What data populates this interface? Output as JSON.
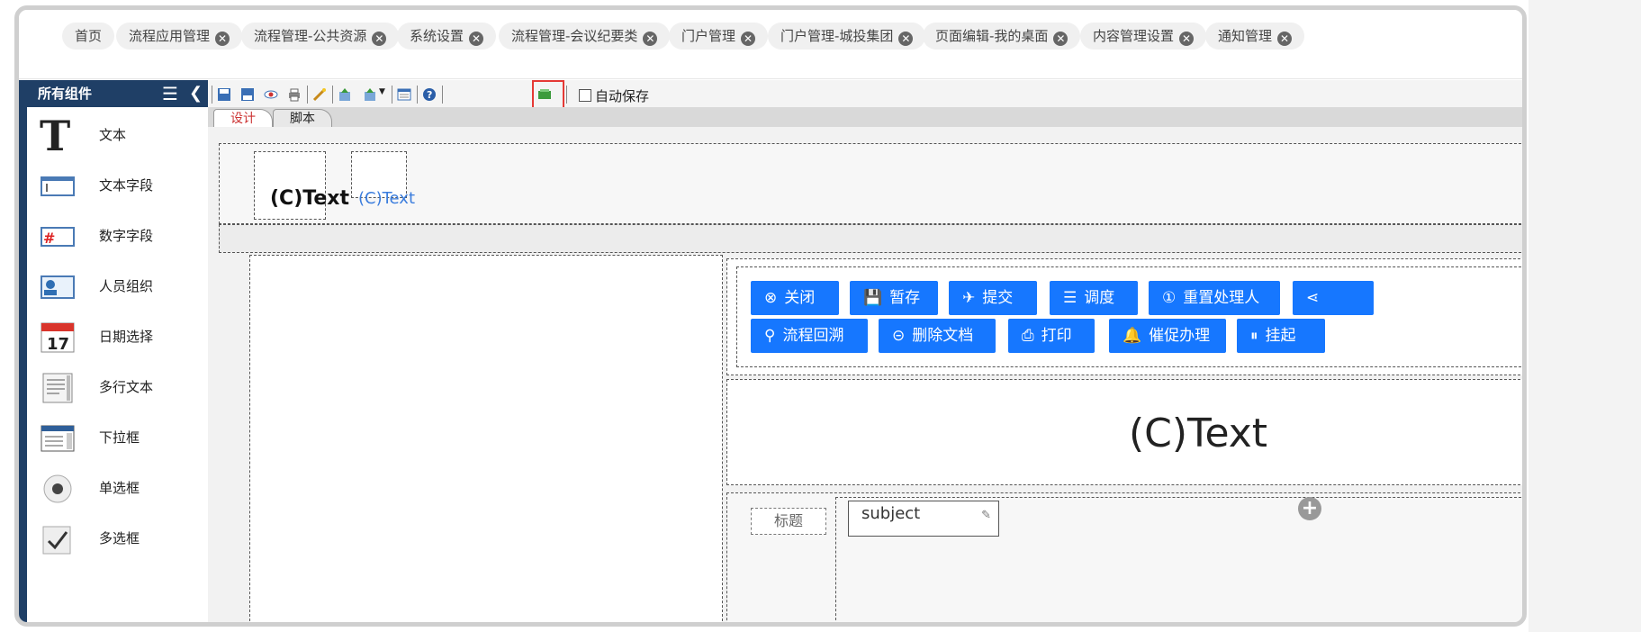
{
  "top_tabs": [
    {
      "label": "首页",
      "closable": false
    },
    {
      "label": "流程应用管理",
      "closable": true
    },
    {
      "label": "流程管理-公共资源",
      "closable": true
    },
    {
      "label": "系统设置",
      "closable": true
    },
    {
      "label": "流程管理-会议纪要类",
      "closable": true
    },
    {
      "label": "门户管理",
      "closable": true
    },
    {
      "label": "门户管理-城投集团",
      "closable": true
    },
    {
      "label": "页面编辑-我的桌面",
      "closable": true
    },
    {
      "label": "内容管理设置",
      "closable": true
    },
    {
      "label": "通知管理",
      "closable": true
    }
  ],
  "close_glyph": "✕",
  "sidebar": {
    "title": "所有组件",
    "items": [
      {
        "label": "文本",
        "icon": "text-T-icon"
      },
      {
        "label": "文本字段",
        "icon": "text-field-icon"
      },
      {
        "label": "数字字段",
        "icon": "number-field-icon"
      },
      {
        "label": "人员组织",
        "icon": "user-org-icon"
      },
      {
        "label": "日期选择",
        "icon": "calendar-icon"
      },
      {
        "label": "多行文本",
        "icon": "textarea-icon"
      },
      {
        "label": "下拉框",
        "icon": "select-icon"
      },
      {
        "label": "单选框",
        "icon": "radio-icon"
      },
      {
        "label": "多选框",
        "icon": "checkbox-icon"
      }
    ]
  },
  "toolbar": {
    "autosave_label": "自动保存",
    "icons": [
      "save-icon",
      "save-as-icon",
      "preview-icon",
      "print-icon",
      "wand-icon",
      "import-icon",
      "export-icon",
      "form-icon",
      "help-icon",
      "green-box-icon"
    ]
  },
  "editor_tabs": {
    "design": "设计",
    "script": "脚本"
  },
  "canvas": {
    "text1": "(C)Text",
    "text2": "(C)Text",
    "text3": "(C)Text",
    "field_label": "标题",
    "field_value": "subject"
  },
  "buttons_row1": [
    {
      "label": "关闭",
      "icon": "⊗"
    },
    {
      "label": "暂存",
      "icon": "💾"
    },
    {
      "label": "提交",
      "icon": "✈"
    },
    {
      "label": "调度",
      "icon": "☰"
    },
    {
      "label": "重置处理人",
      "icon": "①"
    },
    {
      "label": "",
      "icon": "⋖"
    }
  ],
  "buttons_row2": [
    {
      "label": "流程回溯",
      "icon": "⚲"
    },
    {
      "label": "删除文档",
      "icon": "⊝"
    },
    {
      "label": "打印",
      "icon": "⎙"
    },
    {
      "label": "催促办理",
      "icon": "🔔"
    },
    {
      "label": "挂起",
      "icon": "⏸"
    }
  ],
  "colors": {
    "primary": "#1677ff",
    "sidebar_header": "#1f3f66",
    "highlight": "#e53935"
  }
}
